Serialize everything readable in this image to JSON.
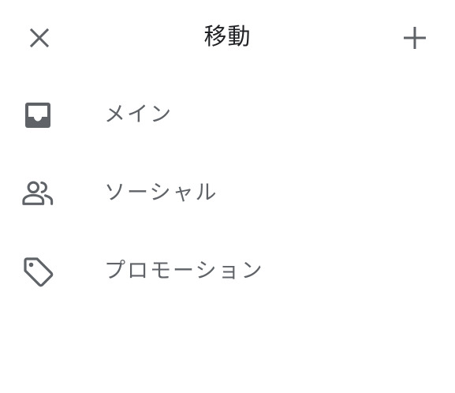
{
  "header": {
    "title": "移動",
    "close_icon": "close-icon",
    "add_icon": "plus-icon"
  },
  "menu": {
    "items": [
      {
        "label": "メイン",
        "icon": "inbox-icon"
      },
      {
        "label": "ソーシャル",
        "icon": "people-icon"
      },
      {
        "label": "プロモーション",
        "icon": "tag-icon"
      }
    ]
  },
  "colors": {
    "icon": "#5f6368",
    "title": "#202124",
    "background": "#ffffff"
  }
}
